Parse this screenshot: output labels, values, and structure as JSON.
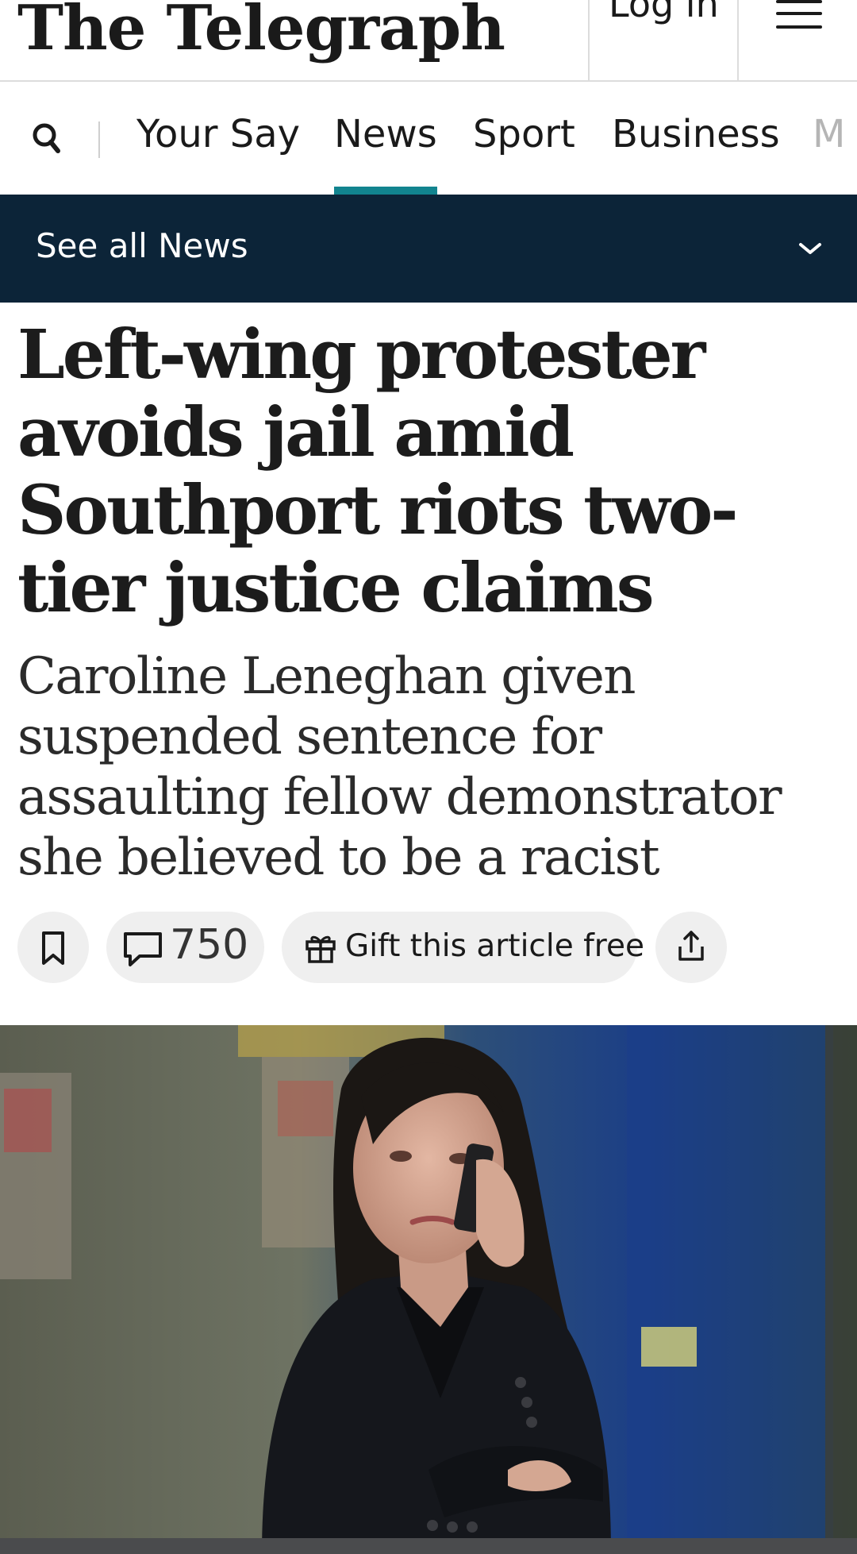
{
  "header": {
    "logo": "The Telegraph",
    "login_label": "Log in"
  },
  "nav": {
    "items": [
      {
        "label": "Your Say"
      },
      {
        "label": "News"
      },
      {
        "label": "Sport"
      },
      {
        "label": "Business"
      },
      {
        "label": "M"
      }
    ],
    "active": "News"
  },
  "section_bar": {
    "label": "See all News"
  },
  "article": {
    "headline": "Left-wing protester avoids jail amid Southport riots two-tier justice claims",
    "standfirst": "Caroline Leneghan given suspended sentence for assaulting fellow demonstrator she believed to be a racist"
  },
  "actions": {
    "comment_count": "750",
    "gift_label": "Gift this article free"
  },
  "icons": [
    "search-icon",
    "menu-icon",
    "chevron-down-icon",
    "bookmark-icon",
    "comment-icon",
    "gift-icon",
    "share-icon"
  ],
  "colors": {
    "accent_teal": "#12848f",
    "section_bar_navy": "#0c2438",
    "pill_grey": "#efefef"
  }
}
